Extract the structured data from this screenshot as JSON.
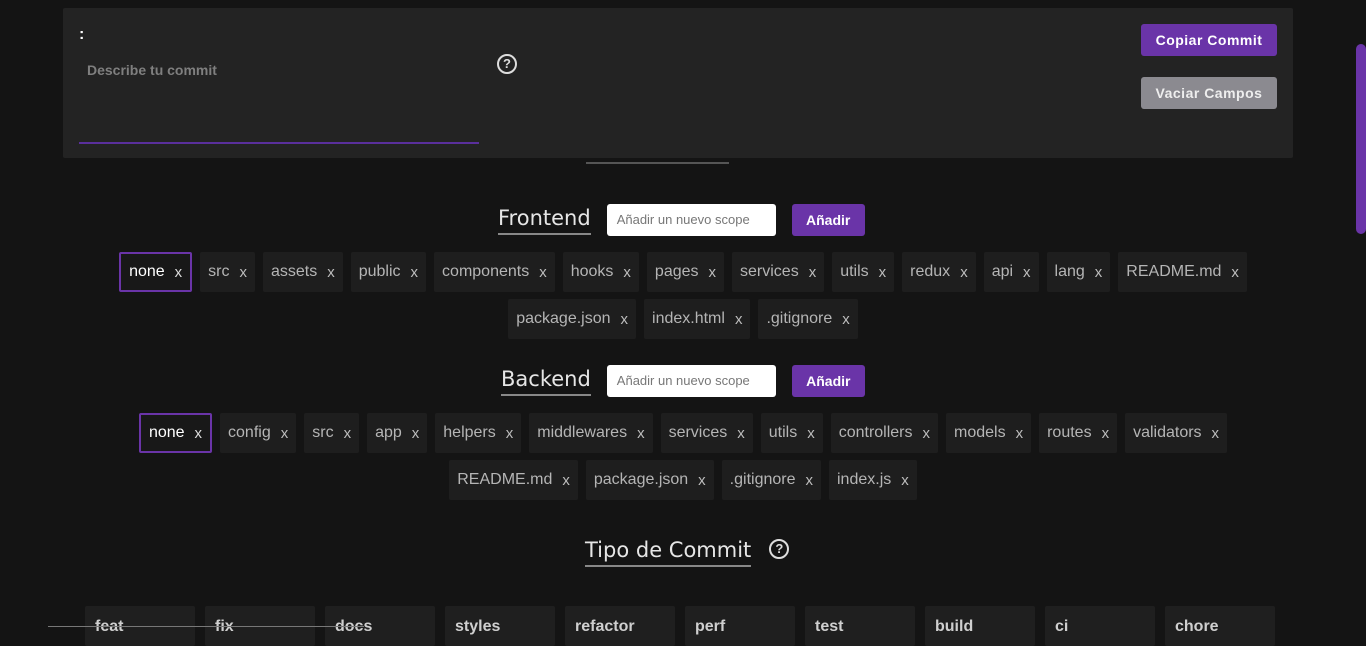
{
  "commit_panel": {
    "prefix": ":",
    "description_placeholder": "Describe tu commit",
    "help_glyph": "?",
    "copy_label": "Copiar Commit",
    "clear_label": "Vaciar Campos"
  },
  "frontend": {
    "title": "Frontend",
    "scope_placeholder": "Añadir un nuevo scope",
    "add_label": "Añadir",
    "scopes_row1": [
      "none",
      "src",
      "assets",
      "public",
      "components",
      "hooks",
      "pages",
      "services",
      "utils",
      "redux",
      "api",
      "lang",
      "README.md"
    ],
    "scopes_row2": [
      "package.json",
      "index.html",
      ".gitignore"
    ],
    "selected": "none"
  },
  "backend": {
    "title": "Backend",
    "scope_placeholder": "Añadir un nuevo scope",
    "add_label": "Añadir",
    "scopes_row1": [
      "none",
      "config",
      "src",
      "app",
      "helpers",
      "middlewares",
      "services",
      "utils",
      "controllers",
      "models",
      "routes",
      "validators"
    ],
    "scopes_row2": [
      "README.md",
      "package.json",
      ".gitignore",
      "index.js"
    ],
    "selected": "none"
  },
  "commit_type": {
    "title": "Tipo de Commit",
    "help_glyph": "?",
    "types": [
      "feat",
      "fix",
      "docs",
      "styles",
      "refactor",
      "perf",
      "test",
      "build",
      "ci",
      "chore"
    ]
  },
  "remove_glyph": "x",
  "colors": {
    "accent": "#6a34a8",
    "background": "#141414",
    "panel": "#232323"
  }
}
